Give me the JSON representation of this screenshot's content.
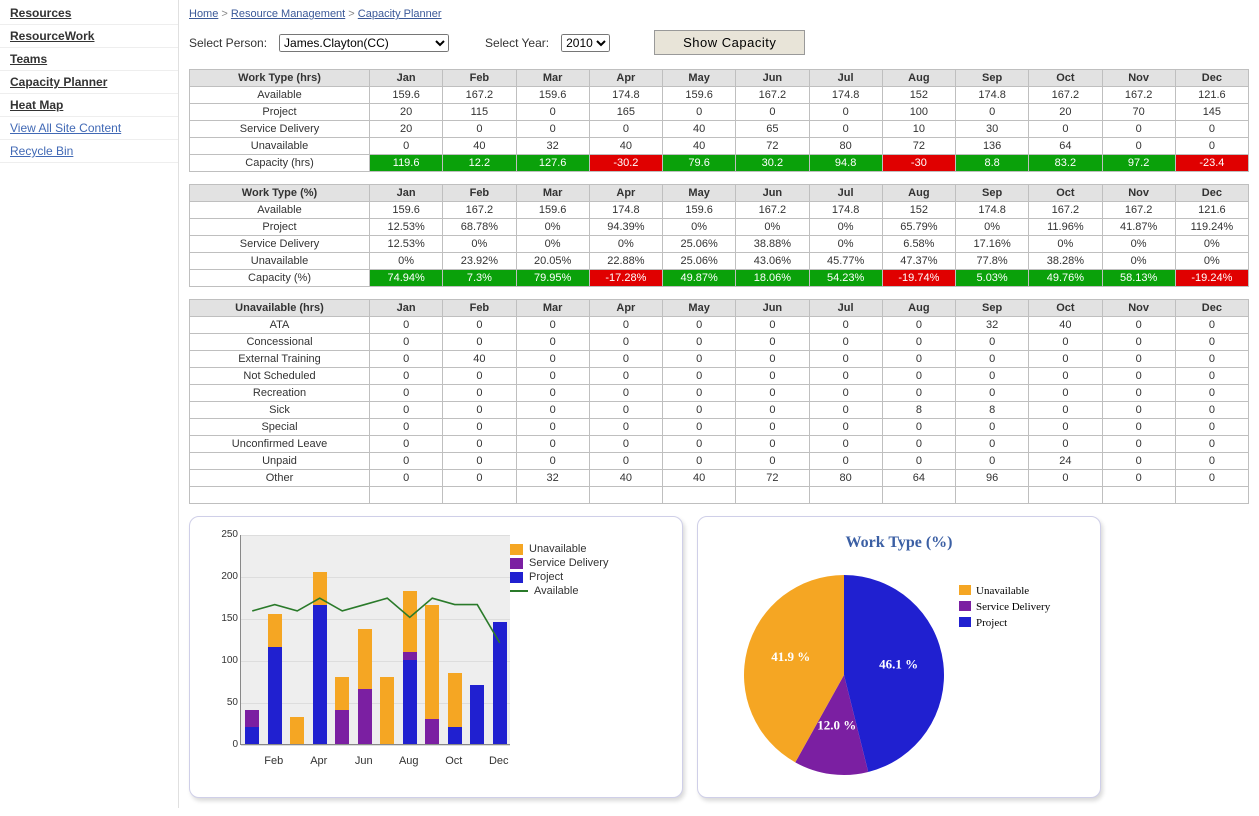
{
  "sidebar": {
    "items": [
      {
        "label": "Resources"
      },
      {
        "label": "ResourceWork"
      },
      {
        "label": "Teams"
      },
      {
        "label": "Capacity Planner"
      },
      {
        "label": "Heat Map"
      },
      {
        "label": "View All Site Content"
      },
      {
        "label": " Recycle Bin"
      }
    ]
  },
  "breadcrumb": {
    "home": "Home",
    "rm": "Resource Management",
    "cp": "Capacity Planner",
    "sep": " > "
  },
  "controls": {
    "personLabel": "Select Person:",
    "personValue": "James.Clayton(CC)",
    "yearLabel": "Select Year:",
    "yearValue": "2010",
    "buttonLabel": "Show Capacity"
  },
  "months": [
    "Jan",
    "Feb",
    "Mar",
    "Apr",
    "May",
    "Jun",
    "Jul",
    "Aug",
    "Sep",
    "Oct",
    "Nov",
    "Dec"
  ],
  "tables": {
    "hrs": {
      "header": "Work Type (hrs)",
      "rows": [
        {
          "label": "Available",
          "v": [
            "159.6",
            "167.2",
            "159.6",
            "174.8",
            "159.6",
            "167.2",
            "174.8",
            "152",
            "174.8",
            "167.2",
            "167.2",
            "121.6"
          ]
        },
        {
          "label": "Project",
          "v": [
            "20",
            "115",
            "0",
            "165",
            "0",
            "0",
            "0",
            "100",
            "0",
            "20",
            "70",
            "145"
          ]
        },
        {
          "label": "Service Delivery",
          "v": [
            "20",
            "0",
            "0",
            "0",
            "40",
            "65",
            "0",
            "10",
            "30",
            "0",
            "0",
            "0"
          ]
        },
        {
          "label": "Unavailable",
          "v": [
            "0",
            "40",
            "32",
            "40",
            "40",
            "72",
            "80",
            "72",
            "136",
            "64",
            "0",
            "0"
          ]
        },
        {
          "label": "Capacity (hrs)",
          "v": [
            "119.6",
            "12.2",
            "127.6",
            "-30.2",
            "79.6",
            "30.2",
            "94.8",
            "-30",
            "8.8",
            "83.2",
            "97.2",
            "-23.4"
          ]
        }
      ]
    },
    "pct": {
      "header": "Work Type (%)",
      "rows": [
        {
          "label": "Available",
          "v": [
            "159.6",
            "167.2",
            "159.6",
            "174.8",
            "159.6",
            "167.2",
            "174.8",
            "152",
            "174.8",
            "167.2",
            "167.2",
            "121.6"
          ]
        },
        {
          "label": "Project",
          "v": [
            "12.53%",
            "68.78%",
            "0%",
            "94.39%",
            "0%",
            "0%",
            "0%",
            "65.79%",
            "0%",
            "11.96%",
            "41.87%",
            "119.24%"
          ]
        },
        {
          "label": "Service Delivery",
          "v": [
            "12.53%",
            "0%",
            "0%",
            "0%",
            "25.06%",
            "38.88%",
            "0%",
            "6.58%",
            "17.16%",
            "0%",
            "0%",
            "0%"
          ]
        },
        {
          "label": "Unavailable",
          "v": [
            "0%",
            "23.92%",
            "20.05%",
            "22.88%",
            "25.06%",
            "43.06%",
            "45.77%",
            "47.37%",
            "77.8%",
            "38.28%",
            "0%",
            "0%"
          ]
        },
        {
          "label": "Capacity (%)",
          "v": [
            "74.94%",
            "7.3%",
            "79.95%",
            "-17.28%",
            "49.87%",
            "18.06%",
            "54.23%",
            "-19.74%",
            "5.03%",
            "49.76%",
            "58.13%",
            "-19.24%"
          ]
        }
      ]
    },
    "unavail": {
      "header": "Unavailable (hrs)",
      "rows": [
        {
          "label": "ATA",
          "v": [
            "0",
            "0",
            "0",
            "0",
            "0",
            "0",
            "0",
            "0",
            "32",
            "40",
            "0",
            "0"
          ]
        },
        {
          "label": "Concessional",
          "v": [
            "0",
            "0",
            "0",
            "0",
            "0",
            "0",
            "0",
            "0",
            "0",
            "0",
            "0",
            "0"
          ]
        },
        {
          "label": "External Training",
          "v": [
            "0",
            "40",
            "0",
            "0",
            "0",
            "0",
            "0",
            "0",
            "0",
            "0",
            "0",
            "0"
          ]
        },
        {
          "label": "Not Scheduled",
          "v": [
            "0",
            "0",
            "0",
            "0",
            "0",
            "0",
            "0",
            "0",
            "0",
            "0",
            "0",
            "0"
          ]
        },
        {
          "label": "Recreation",
          "v": [
            "0",
            "0",
            "0",
            "0",
            "0",
            "0",
            "0",
            "0",
            "0",
            "0",
            "0",
            "0"
          ]
        },
        {
          "label": "Sick",
          "v": [
            "0",
            "0",
            "0",
            "0",
            "0",
            "0",
            "0",
            "8",
            "8",
            "0",
            "0",
            "0"
          ]
        },
        {
          "label": "Special",
          "v": [
            "0",
            "0",
            "0",
            "0",
            "0",
            "0",
            "0",
            "0",
            "0",
            "0",
            "0",
            "0"
          ]
        },
        {
          "label": "Unconfirmed Leave",
          "v": [
            "0",
            "0",
            "0",
            "0",
            "0",
            "0",
            "0",
            "0",
            "0",
            "0",
            "0",
            "0"
          ]
        },
        {
          "label": "Unpaid",
          "v": [
            "0",
            "0",
            "0",
            "0",
            "0",
            "0",
            "0",
            "0",
            "0",
            "24",
            "0",
            "0"
          ]
        },
        {
          "label": "Other",
          "v": [
            "0",
            "0",
            "32",
            "40",
            "40",
            "72",
            "80",
            "64",
            "96",
            "0",
            "0",
            "0"
          ]
        }
      ]
    }
  },
  "chart_data": [
    {
      "type": "bar",
      "stacked": true,
      "categories": [
        "Jan",
        "Feb",
        "Mar",
        "Apr",
        "May",
        "Jun",
        "Jul",
        "Aug",
        "Sep",
        "Oct",
        "Nov",
        "Dec"
      ],
      "series": [
        {
          "name": "Project",
          "color": "#2020d0",
          "values": [
            20,
            115,
            0,
            165,
            0,
            0,
            0,
            100,
            0,
            20,
            70,
            145
          ]
        },
        {
          "name": "Service Delivery",
          "color": "#7b1fa2",
          "values": [
            20,
            0,
            0,
            0,
            40,
            65,
            0,
            10,
            30,
            0,
            0,
            0
          ]
        },
        {
          "name": "Unavailable",
          "color": "#f5a623",
          "values": [
            0,
            40,
            32,
            40,
            40,
            72,
            80,
            72,
            136,
            64,
            0,
            0
          ]
        }
      ],
      "line": {
        "name": "Available",
        "color": "#2a7a2a",
        "values": [
          159.6,
          167.2,
          159.6,
          174.8,
          159.6,
          167.2,
          174.8,
          152,
          174.8,
          167.2,
          167.2,
          121.6
        ]
      },
      "ylim": [
        0,
        250
      ],
      "yticks": [
        0,
        50,
        100,
        150,
        200,
        250
      ],
      "xlabel": "",
      "ylabel": ""
    },
    {
      "type": "pie",
      "title": "Work Type (%)",
      "slices": [
        {
          "name": "Project",
          "color": "#2020d0",
          "value": 46.1,
          "label": "46.1 %"
        },
        {
          "name": "Service Delivery",
          "color": "#7b1fa2",
          "value": 12.0,
          "label": "12.0 %"
        },
        {
          "name": "Unavailable",
          "color": "#f5a623",
          "value": 41.9,
          "label": "41.9 %"
        }
      ],
      "legend": [
        "Unavailable",
        "Service Delivery",
        "Project"
      ]
    }
  ],
  "legendLabels": {
    "Unavailable": "Unavailable",
    "Service Delivery": "Service Delivery",
    "Project": "Project",
    "Available": "Available"
  }
}
